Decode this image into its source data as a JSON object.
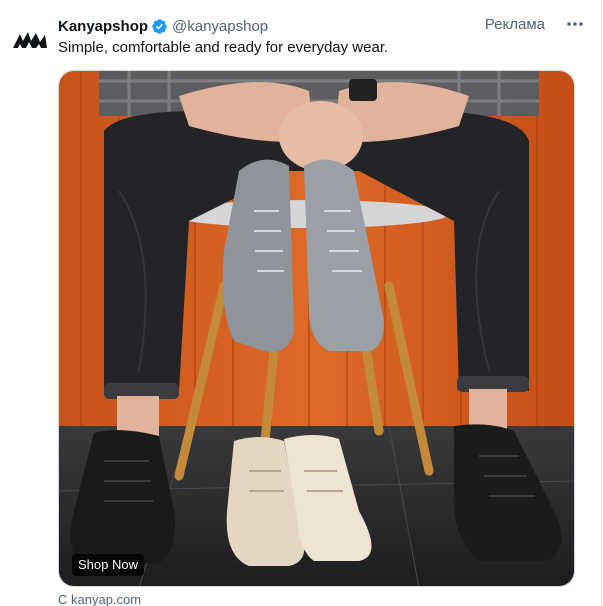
{
  "author": {
    "name": "Kanyapshop",
    "handle": "@kanyapshop",
    "verified": true,
    "avatar_icon": "kanyap-logo-icon"
  },
  "ad_label": "Реклама",
  "more_icon": "more-dots-icon",
  "tweet_text": "Simple, comfortable and ready for everyday wear.",
  "media": {
    "cta_label": "Shop Now"
  },
  "source_link": "С kanyap.com",
  "colors": {
    "verified_blue": "#1d9bf0",
    "muted_text": "#536471",
    "main_text": "#0f1419",
    "background_orange": "#d05a1c"
  }
}
